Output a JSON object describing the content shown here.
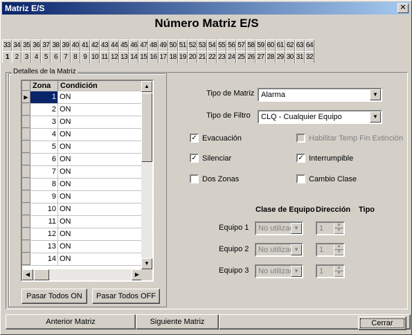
{
  "window": {
    "title": "Matriz E/S",
    "close": "✕"
  },
  "heading": "Número Matriz E/S",
  "tabs_top": [
    "33",
    "34",
    "35",
    "36",
    "37",
    "38",
    "39",
    "40",
    "41",
    "42",
    "43",
    "44",
    "45",
    "46",
    "47",
    "48",
    "49",
    "50",
    "51",
    "52",
    "53",
    "54",
    "55",
    "56",
    "57",
    "58",
    "59",
    "60",
    "61",
    "62",
    "63",
    "64"
  ],
  "tabs_bottom": [
    "1",
    "2",
    "3",
    "4",
    "5",
    "6",
    "7",
    "8",
    "9",
    "10",
    "11",
    "12",
    "13",
    "14",
    "15",
    "16",
    "17",
    "18",
    "19",
    "20",
    "21",
    "22",
    "23",
    "24",
    "25",
    "26",
    "27",
    "28",
    "29",
    "30",
    "31",
    "32"
  ],
  "group_title": "Detalles de la Matriz",
  "grid": {
    "headers": [
      "Zona",
      "Condición"
    ],
    "rows": [
      {
        "zona": "1",
        "cond": "ON"
      },
      {
        "zona": "2",
        "cond": "ON"
      },
      {
        "zona": "3",
        "cond": "ON"
      },
      {
        "zona": "4",
        "cond": "ON"
      },
      {
        "zona": "5",
        "cond": "ON"
      },
      {
        "zona": "6",
        "cond": "ON"
      },
      {
        "zona": "7",
        "cond": "ON"
      },
      {
        "zona": "8",
        "cond": "ON"
      },
      {
        "zona": "9",
        "cond": "ON"
      },
      {
        "zona": "10",
        "cond": "ON"
      },
      {
        "zona": "11",
        "cond": "ON"
      },
      {
        "zona": "12",
        "cond": "ON"
      },
      {
        "zona": "13",
        "cond": "ON"
      },
      {
        "zona": "14",
        "cond": "ON"
      }
    ]
  },
  "buttons": {
    "all_on": "Pasar Todos ON",
    "all_off": "Pasar Todos OFF",
    "prev": "Anterior Matriz",
    "next": "Siguiente Matriz",
    "close": "Cerrar"
  },
  "form": {
    "tipo_matriz_label": "Tipo de Matriz",
    "tipo_matriz_value": "Alarma",
    "tipo_filtro_label": "Tipo de Filtro",
    "tipo_filtro_value": "CLQ - Cualquier Equipo",
    "evacuacion": "Evacuación",
    "habilitar": "Habilitar Temp Fin Extinción",
    "silenciar": "Silenciar",
    "interrumpible": "Interrumpible",
    "dos_zonas": "Dos Zonas",
    "cambio_clase": "Cambio Clase",
    "col_clase": "Clase de Equipo",
    "col_dir": "Dirección",
    "col_tipo": "Tipo",
    "equipos": [
      {
        "label": "Equipo 1",
        "clase": "No utilizado",
        "dir": "1"
      },
      {
        "label": "Equipo 2",
        "clase": "No utilizado",
        "dir": "1"
      },
      {
        "label": "Equipo 3",
        "clase": "No utilizado",
        "dir": "1"
      }
    ]
  },
  "checked": {
    "evacuacion": true,
    "silenciar": true,
    "interrumpible": true,
    "dos_zonas": false,
    "cambio_clase": false,
    "habilitar": false
  }
}
